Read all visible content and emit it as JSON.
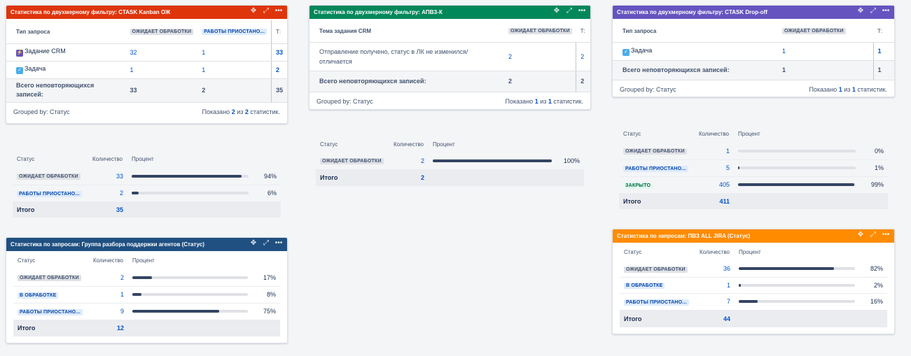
{
  "gadget1": {
    "title": "Статистика по двухмерному фильтру: CTASK Kanban ОЖ",
    "color": "#de350b",
    "col_type": "Тип запроса",
    "col_a": "ОЖИДАЕТ ОБРАБОТКИ",
    "col_b": "РАБОТЫ ПРИОСТАНО...",
    "col_t": "Т:",
    "rows": [
      {
        "name": "Задание CRM",
        "a": "32",
        "b": "1",
        "t": "33"
      },
      {
        "name": "Задача",
        "a": "1",
        "b": "1",
        "t": "2"
      }
    ],
    "total_label": "Всего неповторяющихся записей:",
    "total_a": "33",
    "total_b": "2",
    "total_t": "35",
    "grouped": "Grouped by: Статус",
    "shown_pre": "Показано",
    "shown_x": "2",
    "shown_mid": "из",
    "shown_y": "2",
    "shown_post": "статистик."
  },
  "gadget2": {
    "title": "Статистика по двухмерному фильтру: АПВЗ-К",
    "color": "#00875a",
    "col_type": "Тема задания CRM",
    "col_a": "ОЖИДАЕТ ОБРАБОТКИ",
    "col_t": "Т:",
    "row_name_1": "Отправление получено, статус в ЛК не изменился/",
    "row_name_2": "отличается",
    "row_a": "2",
    "row_t": "2",
    "total_label": "Всего неповторяющихся записей:",
    "total_a": "2",
    "total_t": "2",
    "grouped": "Grouped by: Статус",
    "shown_pre": "Показано",
    "shown_x": "1",
    "shown_mid": "из",
    "shown_y": "1",
    "shown_post": "статистик."
  },
  "gadget3": {
    "title": "Статистика по двухмерному фильтру: CTASK Drop-off",
    "color": "#6554c0",
    "col_type": "Тип запроса",
    "col_a": "ОЖИДАЕТ ОБРАБОТКИ",
    "col_t": "Т:",
    "row_name": "Задача",
    "row_a": "1",
    "row_t": "1",
    "total_label": "Всего неповторяющихся записей:",
    "total_a": "1",
    "total_t": "1",
    "grouped": "Grouped by: Статус",
    "shown_pre": "Показано",
    "shown_x": "1",
    "shown_mid": "из",
    "shown_y": "1",
    "shown_post": "статистик."
  },
  "headers": {
    "status": "Статус",
    "count": "Количество",
    "percent": "Процент",
    "total": "Итого"
  },
  "stat1": {
    "rows": [
      {
        "status": "ОЖИДАЕТ ОБРАБОТКИ",
        "count": "33",
        "pct": "94%",
        "fill": 0.94
      },
      {
        "status": "РАБОТЫ ПРИОСТАНО...",
        "count": "2",
        "pct": "6%",
        "fill": 0.06
      }
    ],
    "total": "35"
  },
  "stat2": {
    "rows": [
      {
        "status": "ОЖИДАЕТ ОБРАБОТКИ",
        "count": "2",
        "pct": "100%",
        "fill": 1.0
      }
    ],
    "total": "2"
  },
  "stat3": {
    "rows": [
      {
        "status": "ОЖИДАЕТ ОБРАБОТКИ",
        "count": "1",
        "pct": "0%",
        "fill": 0.0
      },
      {
        "status": "РАБОТЫ ПРИОСТАНО...",
        "count": "5",
        "pct": "1%",
        "fill": 0.01
      },
      {
        "status": "ЗАКРЫТО",
        "count": "405",
        "pct": "99%",
        "fill": 0.99
      }
    ],
    "total": "411"
  },
  "gadget4": {
    "title": "Статистика по запросам: Группа разбора поддержки агентов (Статус)",
    "color": "#205081",
    "rows": [
      {
        "status": "ОЖИДАЕТ ОБРАБОТКИ",
        "count": "2",
        "pct": "17%",
        "fill": 0.17
      },
      {
        "status": "В ОБРАБОТКЕ",
        "count": "1",
        "pct": "8%",
        "fill": 0.08
      },
      {
        "status": "РАБОТЫ ПРИОСТАНО...",
        "count": "9",
        "pct": "75%",
        "fill": 0.75
      }
    ],
    "total": "12"
  },
  "gadget5": {
    "title": "Статистика по запросам: ПВЗ ALL JIRA (Статус)",
    "color": "#ff8b00",
    "rows": [
      {
        "status": "ОЖИДАЕТ ОБРАБОТКИ",
        "count": "36",
        "pct": "82%",
        "fill": 0.82
      },
      {
        "status": "В ОБРАБОТКЕ",
        "count": "1",
        "pct": "2%",
        "fill": 0.02
      },
      {
        "status": "РАБОТЫ ПРИОСТАНО...",
        "count": "7",
        "pct": "16%",
        "fill": 0.16
      }
    ],
    "total": "44"
  }
}
